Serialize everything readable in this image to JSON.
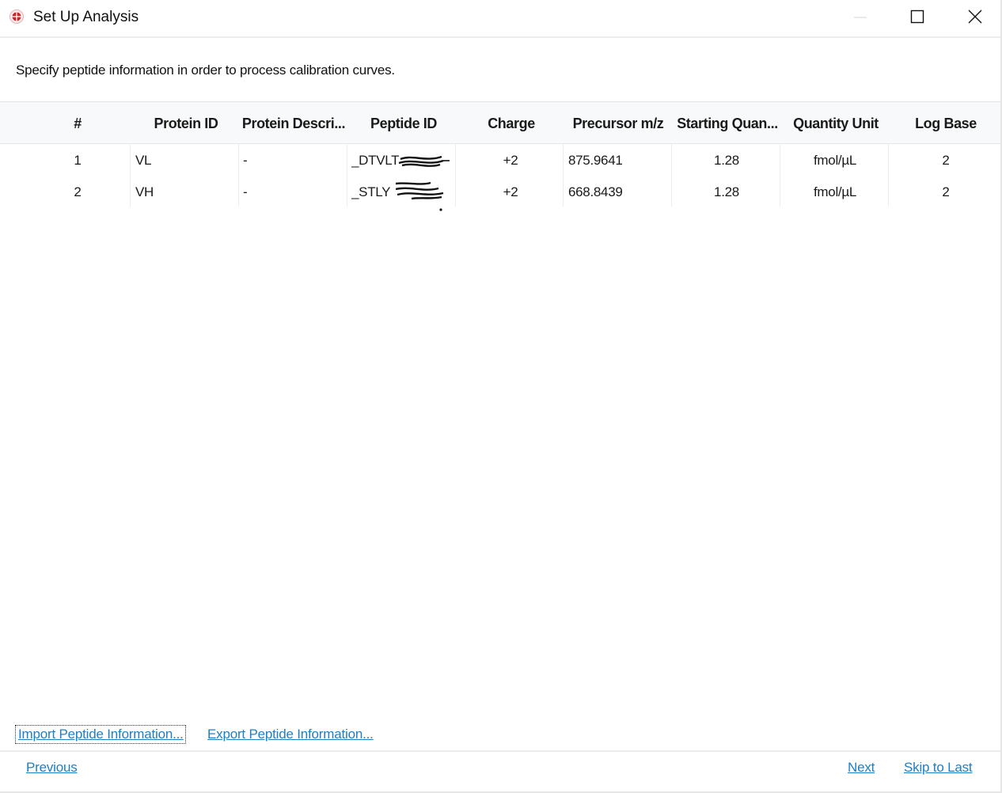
{
  "window": {
    "title": "Set Up Analysis"
  },
  "instructions": "Specify peptide information in order to process calibration curves.",
  "table": {
    "columns": [
      "#",
      "Protein ID",
      "Protein Descri...",
      "Peptide ID",
      "Charge",
      "Precursor m/z",
      "Starting Quan...",
      "Quantity Unit",
      "Log Base"
    ],
    "rows": [
      [
        "1",
        "VL",
        "-",
        "_DTVLT",
        "+2",
        "875.9641",
        "1.28",
        "fmol/µL",
        "2"
      ],
      [
        "2",
        "VH",
        "-",
        "_STLY",
        "+2",
        "668.8439",
        "1.28",
        "fmol/µL",
        "2"
      ]
    ]
  },
  "links": {
    "import": "Import Peptide Information...",
    "export": "Export Peptide Information..."
  },
  "nav": {
    "previous": "Previous",
    "next": "Next",
    "skip_to_last": "Skip to Last"
  },
  "colors": {
    "link": "#1e7fc4",
    "app_icon": "#c0282d",
    "header_bg": "#f7f9fb"
  },
  "icons": {
    "app": "app-logo-icon",
    "minimize": "minimize-icon",
    "maximize": "maximize-icon",
    "close": "close-icon"
  }
}
